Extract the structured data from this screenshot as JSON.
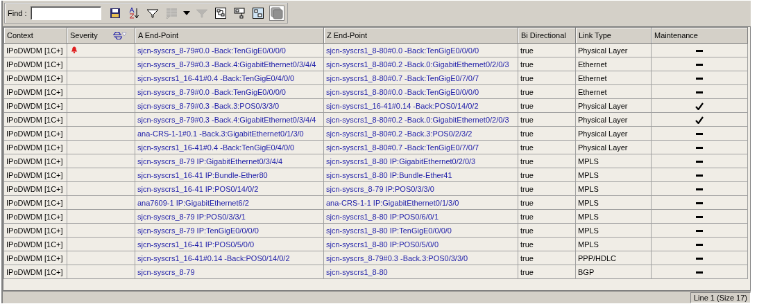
{
  "toolbar": {
    "find_label": "Find :",
    "tools": [
      {
        "kind": "save"
      },
      {
        "kind": "sort"
      },
      {
        "kind": "filter"
      },
      {
        "kind": "grid",
        "disabled": true
      },
      {
        "kind": "caret"
      },
      {
        "kind": "filter",
        "disabled": true
      },
      {
        "kind": "tree"
      },
      {
        "kind": "link"
      },
      {
        "kind": "nodes"
      },
      {
        "kind": "stack",
        "pressed": true
      }
    ]
  },
  "table": {
    "columns": [
      "Context",
      "Severity",
      "A End-Point",
      "Z End-Point",
      "Bi Directional",
      "Link Type",
      "Maintenance"
    ],
    "rows": [
      {
        "context": "IPoDWDM [1C+]",
        "alarm": true,
        "a": "sjcn-syscrs_8-79#0.0 -Back:TenGigE0/0/0/0",
        "z": "sjcn-syscrs1_8-80#0.0 -Back:TenGigE0/0/0/0",
        "bi": "true",
        "link": "Physical Layer",
        "maintenance": false
      },
      {
        "context": "IPoDWDM [1C+]",
        "alarm": false,
        "a": "sjcn-syscrs_8-79#0.3 -Back.4:GigabitEthernet0/3/4/4",
        "z": "sjcn-syscrs1_8-80#0.2 -Back.0:GigabitEthernet0/2/0/3",
        "bi": "true",
        "link": "Ethernet",
        "maintenance": false
      },
      {
        "context": "IPoDWDM [1C+]",
        "alarm": false,
        "a": "sjcn-syscrs1_16-41#0.4 -Back:TenGigE0/4/0/0",
        "z": "sjcn-syscrs1_8-80#0.7 -Back:TenGigE0/7/0/7",
        "bi": "true",
        "link": "Ethernet",
        "maintenance": false
      },
      {
        "context": "IPoDWDM [1C+]",
        "alarm": false,
        "a": "sjcn-syscrs_8-79#0.0 -Back:TenGigE0/0/0/0",
        "z": "sjcn-syscrs1_8-80#0.0 -Back:TenGigE0/0/0/0",
        "bi": "true",
        "link": "Ethernet",
        "maintenance": false
      },
      {
        "context": "IPoDWDM [1C+]",
        "alarm": false,
        "a": "sjcn-syscrs_8-79#0.3 -Back.3:POS0/3/3/0",
        "z": "sjcn-syscrs1_16-41#0.14 -Back:POS0/14/0/2",
        "bi": "true",
        "link": "Physical Layer",
        "maintenance": true
      },
      {
        "context": "IPoDWDM [1C+]",
        "alarm": false,
        "a": "sjcn-syscrs_8-79#0.3 -Back.4:GigabitEthernet0/3/4/4",
        "z": "sjcn-syscrs1_8-80#0.2 -Back.0:GigabitEthernet0/2/0/3",
        "bi": "true",
        "link": "Physical Layer",
        "maintenance": true
      },
      {
        "context": "IPoDWDM [1C+]",
        "alarm": false,
        "a": "ana-CRS-1-1#0.1 -Back.3:GigabitEthernet0/1/3/0",
        "z": "sjcn-syscrs1_8-80#0.2 -Back.3:POS0/2/3/2",
        "bi": "true",
        "link": "Physical Layer",
        "maintenance": false
      },
      {
        "context": "IPoDWDM [1C+]",
        "alarm": false,
        "a": "sjcn-syscrs1_16-41#0.4 -Back:TenGigE0/4/0/0",
        "z": "sjcn-syscrs1_8-80#0.7 -Back:TenGigE0/7/0/7",
        "bi": "true",
        "link": "Physical Layer",
        "maintenance": false
      },
      {
        "context": "IPoDWDM [1C+]",
        "alarm": false,
        "a": "sjcn-syscrs_8-79 IP:GigabitEthernet0/3/4/4",
        "z": "sjcn-syscrs1_8-80 IP:GigabitEthernet0/2/0/3",
        "bi": "true",
        "link": "MPLS",
        "maintenance": false
      },
      {
        "context": "IPoDWDM [1C+]",
        "alarm": false,
        "a": "sjcn-syscrs1_16-41 IP:Bundle-Ether80",
        "z": "sjcn-syscrs1_8-80 IP:Bundle-Ether41",
        "bi": "true",
        "link": "MPLS",
        "maintenance": false
      },
      {
        "context": "IPoDWDM [1C+]",
        "alarm": false,
        "a": "sjcn-syscrs1_16-41 IP:POS0/14/0/2",
        "z": "sjcn-syscrs_8-79 IP:POS0/3/3/0",
        "bi": "true",
        "link": "MPLS",
        "maintenance": false
      },
      {
        "context": "IPoDWDM [1C+]",
        "alarm": false,
        "a": "ana7609-1 IP:GigabitEthernet6/2",
        "z": "ana-CRS-1-1 IP:GigabitEthernet0/1/3/0",
        "bi": "true",
        "link": "MPLS",
        "maintenance": false
      },
      {
        "context": "IPoDWDM [1C+]",
        "alarm": false,
        "a": "sjcn-syscrs_8-79 IP:POS0/3/3/1",
        "z": "sjcn-syscrs1_8-80 IP:POS0/6/0/1",
        "bi": "true",
        "link": "MPLS",
        "maintenance": false
      },
      {
        "context": "IPoDWDM [1C+]",
        "alarm": false,
        "a": "sjcn-syscrs_8-79 IP:TenGigE0/0/0/0",
        "z": "sjcn-syscrs1_8-80 IP:TenGigE0/0/0/0",
        "bi": "true",
        "link": "MPLS",
        "maintenance": false
      },
      {
        "context": "IPoDWDM [1C+]",
        "alarm": false,
        "a": "sjcn-syscrs1_16-41 IP:POS0/5/0/0",
        "z": "sjcn-syscrs1_8-80 IP:POS0/5/0/0",
        "bi": "true",
        "link": "MPLS",
        "maintenance": false
      },
      {
        "context": "IPoDWDM [1C+]",
        "alarm": false,
        "a": "sjcn-syscrs1_16-41#0.14 -Back:POS0/14/0/2",
        "z": "sjcn-syscrs_8-79#0.3 -Back.3:POS0/3/3/0",
        "bi": "true",
        "link": "PPP/HDLC",
        "maintenance": false
      },
      {
        "context": "IPoDWDM [1C+]",
        "alarm": false,
        "a": "sjcn-syscrs_8-79",
        "z": "sjcn-syscrs1_8-80",
        "bi": "true",
        "link": "BGP",
        "maintenance": false
      }
    ]
  },
  "status_bar": {
    "text": "Line 1 (Size 17)"
  }
}
